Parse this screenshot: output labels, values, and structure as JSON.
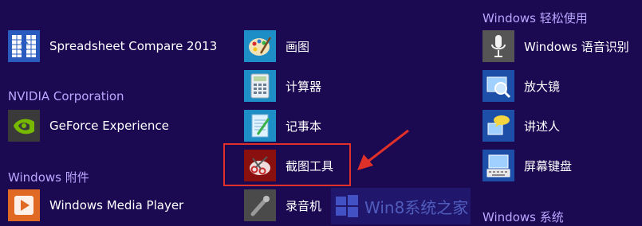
{
  "groups": {
    "nvidia": "NVIDIA Corporation",
    "windows_accessories": "Windows 附件",
    "windows_ease": "Windows 轻松使用",
    "windows_system": "Windows 系统"
  },
  "apps": {
    "spreadsheet_compare": "Spreadsheet Compare 2013",
    "geforce_experience": "GeForce Experience",
    "windows_media_player": "Windows Media Player",
    "paint": "画图",
    "calculator": "计算器",
    "notepad": "记事本",
    "snipping_tool": "截图工具",
    "sound_recorder": "录音机",
    "speech_recognition": "Windows 语音识别",
    "magnifier": "放大镜",
    "narrator": "讲述人",
    "on_screen_keyboard": "屏幕键盘"
  },
  "watermark": {
    "text": "Win8系统之家"
  },
  "colors": {
    "background": "#1b0a52",
    "group_header": "#b9a8ff",
    "highlight": "#e0302a"
  }
}
